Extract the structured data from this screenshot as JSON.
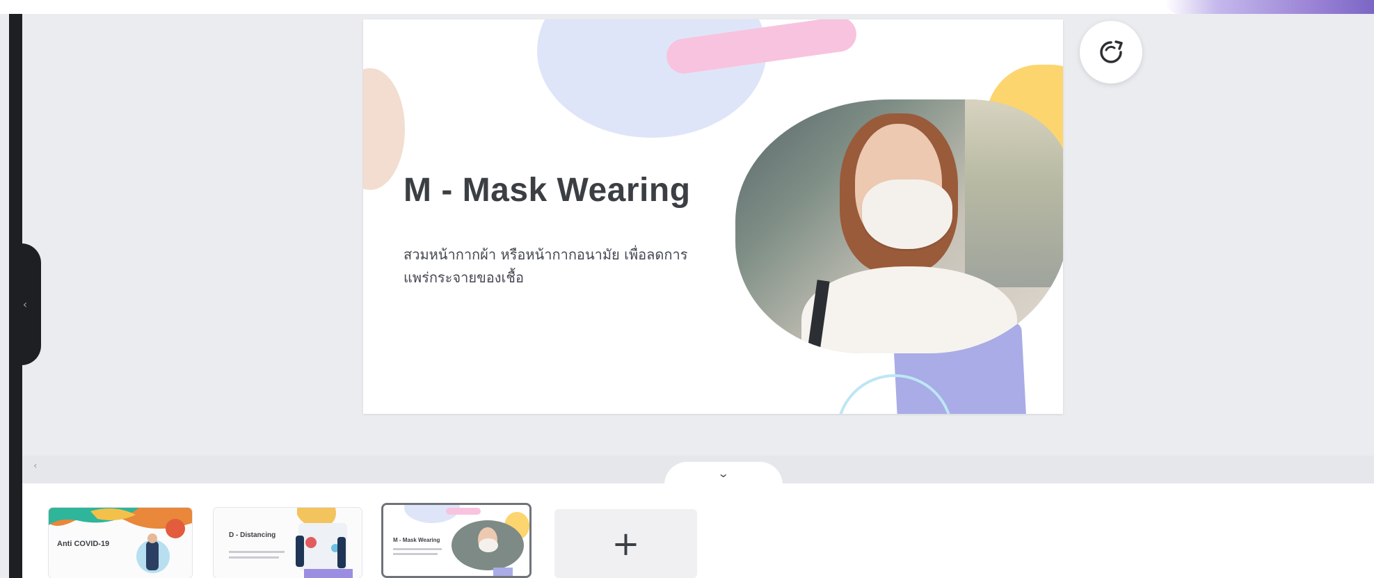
{
  "slide": {
    "title": "M - Mask Wearing",
    "body": "สวมหน้ากากผ้า หรือหน้ากากอนามัย เพื่อลดการแพร่กระจายของเชื้อ"
  },
  "toolbar": {
    "regenerate_icon": "refresh-icon",
    "collapse_icon": "chevron-left-icon",
    "hide_pages_icon": "chevron-down-icon"
  },
  "filmstrip": {
    "add_slide_label": "+",
    "thumbnails": [
      {
        "title": "Anti COVID-19"
      },
      {
        "title": "D - Distancing"
      },
      {
        "title": "M - Mask Wearing"
      }
    ]
  },
  "colors": {
    "canvas": "#ebecf0",
    "rail": "#1e1f22",
    "selected_border": "#6f7379",
    "blob_yellow": "#fdd56f",
    "blob_purple": "#a9ace6",
    "blob_pink": "#f8c3de"
  }
}
